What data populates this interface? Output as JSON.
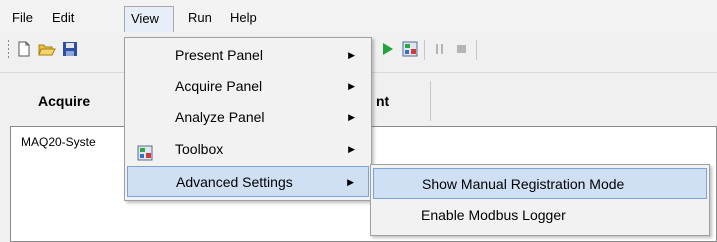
{
  "menubar": {
    "items": [
      {
        "label": "File"
      },
      {
        "label": "Edit"
      },
      {
        "label": "View"
      },
      {
        "label": "Run"
      },
      {
        "label": "Help"
      }
    ]
  },
  "toolbar": {
    "icons": [
      "new-file-icon",
      "open-folder-icon",
      "save-icon",
      "play-icon",
      "toolbox-icon",
      "pause-icon",
      "stop-icon"
    ]
  },
  "buttons": {
    "acquire": "Acquire",
    "partial": "nt"
  },
  "content": {
    "tree_item": "MAQ20-Syste"
  },
  "view_menu": {
    "items": [
      {
        "label": "Present Panel",
        "submenu": true
      },
      {
        "label": "Acquire Panel",
        "submenu": true
      },
      {
        "label": "Analyze Panel",
        "submenu": true
      },
      {
        "label": "Toolbox",
        "submenu": true,
        "icon": "toolbox-icon"
      },
      {
        "label": "Advanced Settings",
        "submenu": true,
        "highlighted": true
      }
    ]
  },
  "advanced_submenu": {
    "items": [
      {
        "label": "Show Manual Registration Mode",
        "highlighted": true
      },
      {
        "label": "Enable Modbus Logger"
      }
    ]
  },
  "colors": {
    "highlight_bg": "#cfe0f4",
    "highlight_border": "#7aa3d6",
    "play_green": "#1fa33a"
  }
}
